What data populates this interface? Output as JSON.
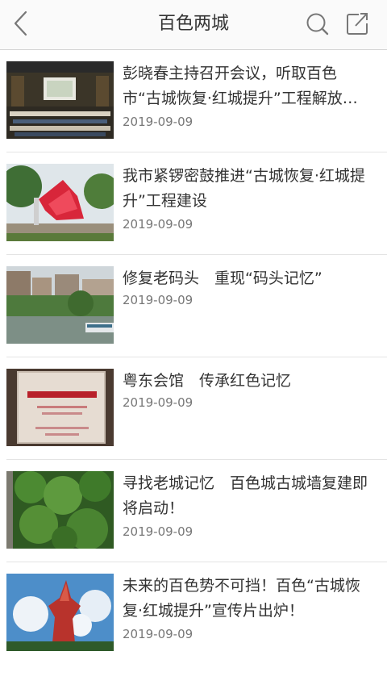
{
  "header": {
    "title": "百色两城",
    "back_icon": "chevron-left-icon",
    "search_icon": "search-icon",
    "share_icon": "share-icon"
  },
  "articles": [
    {
      "title": "彭晓春主持召开会议，听取百色市“古城恢复·红城提升”工程解放…",
      "date": "2019-09-09"
    },
    {
      "title": "我市紧锣密鼓推进“古城恢复·红城提升”工程建设",
      "date": "2019-09-09"
    },
    {
      "title": "修复老码头　重现“码头记忆”",
      "date": "2019-09-09"
    },
    {
      "title": "粤东会馆　传承红色记忆",
      "date": "2019-09-09"
    },
    {
      "title": "寻找老城记忆　百色城古城墙复建即将启动！",
      "date": "2019-09-09"
    },
    {
      "title": "未来的百色势不可挡！百色“古城恢复·红城提升”宣传片出炉！",
      "date": "2019-09-09"
    }
  ]
}
